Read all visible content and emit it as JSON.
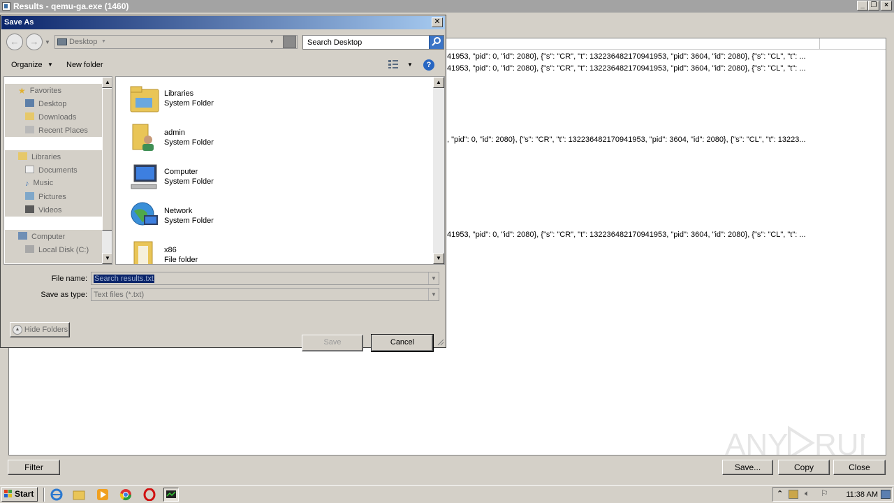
{
  "background_window": {
    "title": "Results - qemu-ga.exe (1460)",
    "result_lines": [
      "41953, \"pid\": 0, \"id\": 2080}, {\"s\": \"CR\", \"t\": 132236482170941953, \"pid\": 3604, \"id\": 2080}, {\"s\": \"CL\", \"t\": ...",
      "41953, \"pid\": 0, \"id\": 2080}, {\"s\": \"CR\", \"t\": 132236482170941953, \"pid\": 3604, \"id\": 2080}, {\"s\": \"CL\", \"t\": ...",
      ", \"pid\": 0, \"id\": 2080}, {\"s\": \"CR\", \"t\": 132236482170941953, \"pid\": 3604, \"id\": 2080}, {\"s\": \"CL\", \"t\": 13223...",
      "41953, \"pid\": 0, \"id\": 2080}, {\"s\": \"CR\", \"t\": 132236482170941953, \"pid\": 3604, \"id\": 2080}, {\"s\": \"CL\", \"t\": ..."
    ],
    "buttons": {
      "filter": "Filter",
      "save": "Save...",
      "copy": "Copy",
      "close": "Close"
    },
    "watermark": "ANY RUN"
  },
  "dialog": {
    "title": "Save As",
    "address": "Desktop",
    "search_placeholder": "Search Desktop",
    "toolbar": {
      "organize": "Organize",
      "new_folder": "New folder"
    },
    "nav": {
      "favorites": "Favorites",
      "favorites_items": [
        "Desktop",
        "Downloads",
        "Recent Places"
      ],
      "libraries": "Libraries",
      "libraries_items": [
        "Documents",
        "Music",
        "Pictures",
        "Videos"
      ],
      "computer": "Computer",
      "computer_items": [
        "Local Disk (C:)"
      ]
    },
    "files": [
      {
        "name": "Libraries",
        "type": "System Folder",
        "icon": "libraries-icon"
      },
      {
        "name": "admin",
        "type": "System Folder",
        "icon": "user-folder-icon"
      },
      {
        "name": "Computer",
        "type": "System Folder",
        "icon": "computer-icon"
      },
      {
        "name": "Network",
        "type": "System Folder",
        "icon": "network-icon"
      },
      {
        "name": "x86",
        "type": "File folder",
        "icon": "folder-icon"
      }
    ],
    "file_name_label": "File name:",
    "file_name_value": "Search results.txt",
    "save_type_label": "Save as type:",
    "save_type_value": "Text files (*.txt)",
    "hide_folders": "Hide Folders",
    "save_button": "Save",
    "cancel_button": "Cancel"
  },
  "taskbar": {
    "start_label": "Start",
    "clock": "11:38 AM"
  },
  "colors": {
    "title_gradient_start": "#0a246a",
    "title_gradient_end": "#a6caf0",
    "face": "#d4d0c8"
  }
}
